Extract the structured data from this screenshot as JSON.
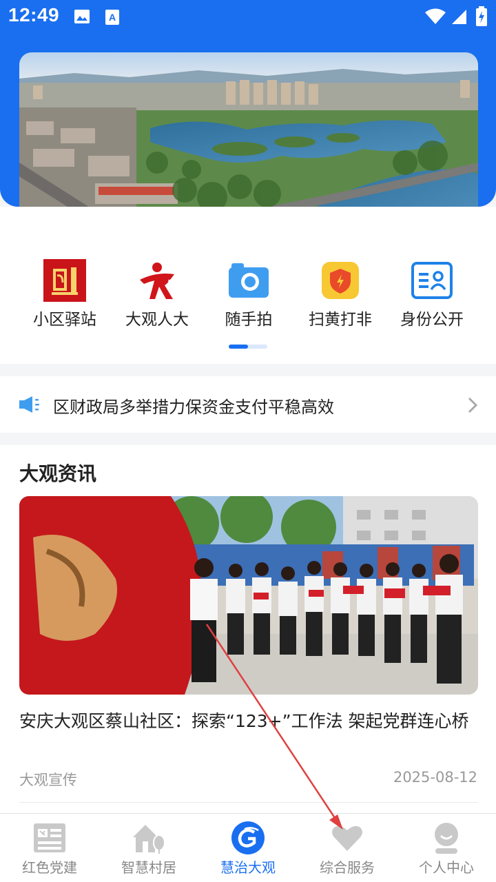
{
  "status_bar": {
    "time": "12:49"
  },
  "shortcuts": [
    {
      "label": "小区驿站",
      "icon": "party-flag-icon"
    },
    {
      "label": "大观人大",
      "icon": "npc-logo-icon"
    },
    {
      "label": "随手拍",
      "icon": "camera-icon"
    },
    {
      "label": "扫黄打非",
      "icon": "shield-icon"
    },
    {
      "label": "身份公开",
      "icon": "id-card-icon"
    }
  ],
  "notice": {
    "text": "区财政局多举措力保资金支付平稳高效",
    "icon": "speaker-icon"
  },
  "news": {
    "heading": "大观资讯",
    "article": {
      "title": "安庆大观区蔡山社区：探索“123+”工作法 架起党群连心桥",
      "source": "大观宣传",
      "date": "2025-08-12"
    }
  },
  "tabs": [
    {
      "label": "红色党建",
      "icon": "party-board-icon",
      "active": false
    },
    {
      "label": "智慧村居",
      "icon": "house-tree-icon",
      "active": false
    },
    {
      "label": "慧治大观",
      "icon": "app-logo-icon",
      "active": true
    },
    {
      "label": "综合服务",
      "icon": "heart-icon",
      "active": false
    },
    {
      "label": "个人中心",
      "icon": "user-icon",
      "active": false
    }
  ],
  "colors": {
    "primary": "#1a6ff0",
    "party_red": "#d0151b",
    "annotation_arrow": "#e04040"
  }
}
